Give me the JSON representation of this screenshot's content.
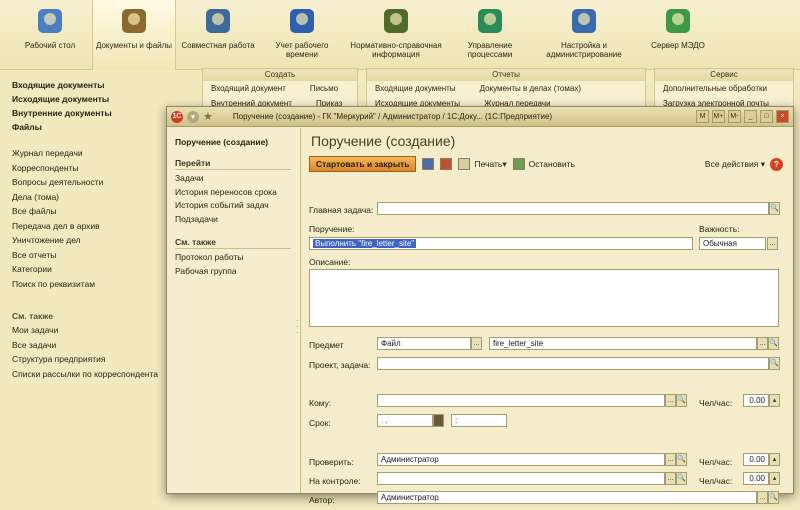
{
  "sections": [
    {
      "label": "Рабочий стол",
      "icon": "desktop-icon",
      "color": "#4a7fc0"
    },
    {
      "label": "Документы и файлы",
      "icon": "documents-icon",
      "color": "#8a6a30",
      "active": true
    },
    {
      "label": "Совместная работа",
      "icon": "people-icon",
      "color": "#3d6a9a"
    },
    {
      "label": "Учет рабочего времени",
      "icon": "clock-icon",
      "color": "#2f5fb0"
    },
    {
      "label": "Нормативно-справочная информация",
      "icon": "books-icon",
      "color": "#4f6a2a",
      "wide": true
    },
    {
      "label": "Управление процессами",
      "icon": "process-icon",
      "color": "#2a8a5a"
    },
    {
      "label": "Настройка и администрирование",
      "icon": "settings-icon",
      "color": "#3a6ab0",
      "wide": true
    },
    {
      "label": "Сервер МЭДО",
      "icon": "server-icon",
      "color": "#3a9a4a"
    }
  ],
  "leftnav": {
    "main": [
      "Входящие документы",
      "Исходящие документы",
      "Внутренние документы",
      "Файлы"
    ],
    "links": [
      "Журнал передачи",
      "Корреспонденты",
      "Вопросы деятельности",
      "Дела (тома)",
      "Все файлы",
      "Передача дел в архив",
      "Уничтожение дел",
      "Все отчеты",
      "Категории",
      "Поиск по реквизитам"
    ],
    "see_also_title": "См. также",
    "see_also": [
      "Мои задачи",
      "Все задачи",
      "Структура предприятия",
      "Списки рассылки по корреспондента"
    ]
  },
  "bg_panels": {
    "create": {
      "title": "Создать",
      "row1": [
        "Входящий документ",
        "Письмо"
      ],
      "row2": [
        "Внутренний документ",
        "Приказ"
      ]
    },
    "reports": {
      "title": "Отчеты",
      "row1": [
        "Входящие документы",
        "Документы в делах (томах)"
      ],
      "row2": [
        "Исходящие документы",
        "Журнал передачи"
      ]
    },
    "service": {
      "title": "Сервис",
      "row1": [
        "Дополнительные обработки"
      ],
      "row2": [
        "Загрузка электронной почты"
      ]
    }
  },
  "window": {
    "title": "Поручение (создание) - ГК \"Меркурий\" / Администратор / 1С:Доку... (1С:Предприятие)",
    "title_right": [
      "M",
      "M+",
      "M-"
    ],
    "side": {
      "current": "Поручение (создание)",
      "goto_title": "Перейти",
      "goto": [
        "Задачи",
        "История переносов срока",
        "История событий задач",
        "Подзадачи"
      ],
      "see_also_title": "См. также",
      "see_also": [
        "Протокол работы",
        "Рабочая группа"
      ]
    },
    "form": {
      "title": "Поручение (создание)",
      "start_button": "Стартовать и закрыть",
      "print_label": "Печать",
      "stop_label": "Остановить",
      "all_actions": "Все действия",
      "main_task_label": "Главная задача:",
      "main_task_value": "",
      "assignment_label": "Поручение:",
      "assignment_value": "Выполнить \"fire_letter_site\"",
      "importance_label": "Важность:",
      "importance_value": "Обычная",
      "description_label": "Описание:",
      "subject_label": "Предмет",
      "subject_type": "Файл",
      "subject_value": "fire_letter_site",
      "project_label": "Проект, задача:",
      "to_label": "Кому:",
      "to_value": "",
      "hours_label": "Чел/час:",
      "hours_to": "0.00",
      "deadline_label": "Срок:",
      "deadline_date": " .  .",
      "deadline_time": " :",
      "checker_label": "Проверить:",
      "checker_value": "Администратор",
      "hours_checker": "0.00",
      "control_label": "На контроле:",
      "control_value": "",
      "hours_control": "0.00",
      "author_label": "Автор:",
      "author_value": "Администратор"
    }
  }
}
